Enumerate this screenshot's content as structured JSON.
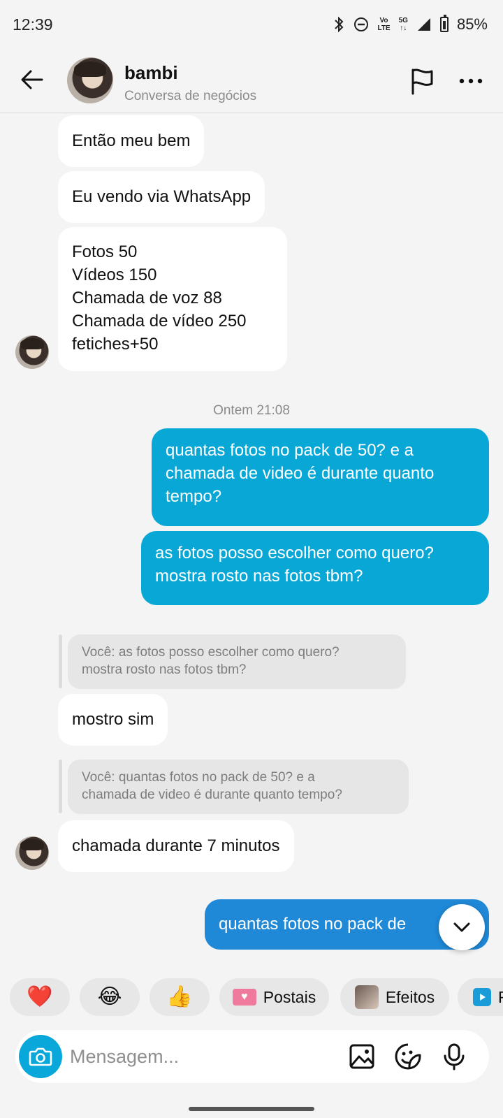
{
  "status_bar": {
    "time": "12:39",
    "volte_top": "Vo",
    "volte_bottom": "LTE",
    "network_top": "5G",
    "network_bottom": "↑↓",
    "battery": "85%"
  },
  "header": {
    "contact_name": "bambi",
    "subtitle": "Conversa de negócios"
  },
  "messages": {
    "m1": "Então meu bem",
    "m2": "Eu vendo via WhatsApp",
    "m3": "Fotos 50\nVídeos 150\nChamada de voz 88\nChamada de vídeo 250\nfetiches+50",
    "timestamp": "Ontem 21:08",
    "o1": "quantas fotos no pack de 50? e a\nchamada de video é durante quanto\ntempo?",
    "o2": "as fotos posso escolher como quero?\nmostra rosto nas fotos tbm?",
    "q1": "Você: as fotos posso escolher como quero?\nmostra rosto nas fotos tbm?",
    "m4": "mostro sim",
    "q2": "Você: quantas fotos no pack de 50? e a\nchamada de video é durante quanto tempo?",
    "m5": "chamada durante 7 minutos",
    "o3": "quantas fotos no pack de"
  },
  "chips": {
    "heart": "❤️",
    "laugh": "😂",
    "thumb": "👍",
    "postais": "Postais",
    "efeitos": "Efeitos",
    "last": "R"
  },
  "composer": {
    "placeholder": "Mensagem..."
  },
  "colors": {
    "outgoing_cyan": "#08a7d5",
    "outgoing_blue": "#1f89d8",
    "incoming": "#ffffff",
    "background": "#f4f4f4"
  }
}
